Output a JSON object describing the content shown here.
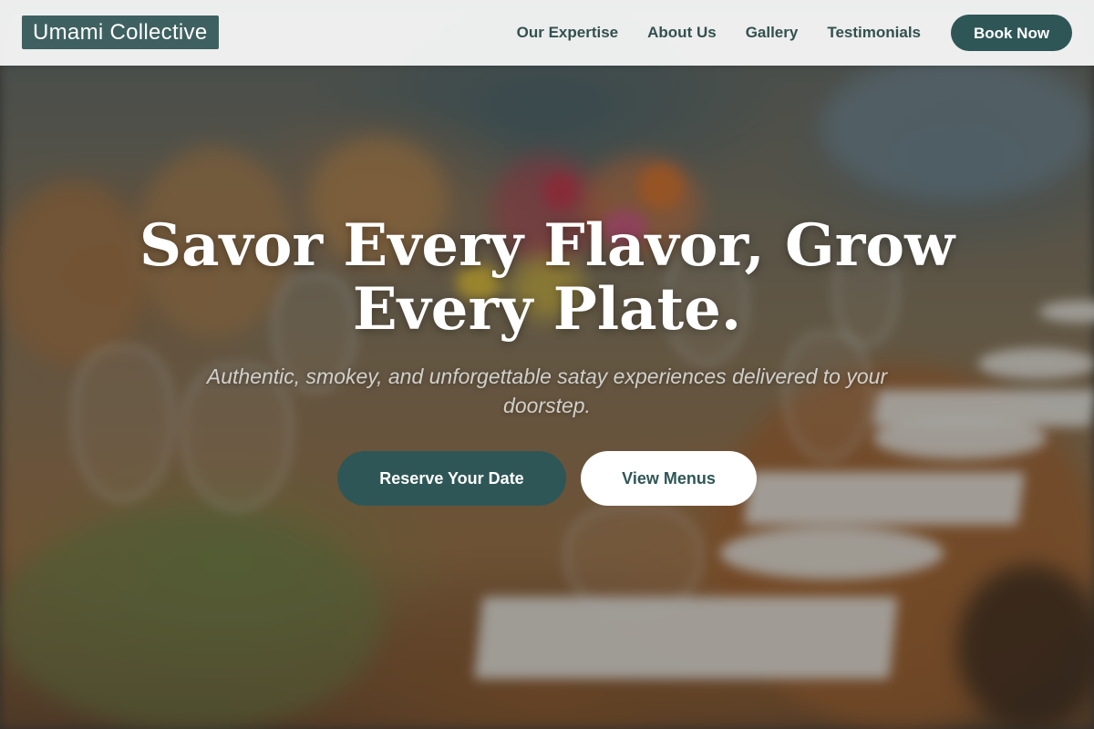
{
  "brand": {
    "name": "Umami Collective"
  },
  "nav": {
    "links": [
      {
        "label": "Our Expertise"
      },
      {
        "label": "About Us"
      },
      {
        "label": "Gallery"
      },
      {
        "label": "Testimonials"
      }
    ],
    "cta_label": "Book Now"
  },
  "hero": {
    "title": "Savor Every Flavor, Grow Every Plate.",
    "subtitle": "Authentic, smokey, and unforgettable satay experiences delivered to your doorstep.",
    "primary_button": "Reserve Your Date",
    "secondary_button": "View Menus",
    "background_image": "blurred-banquet-table-with-glasses-plates-and-flowers"
  },
  "colors": {
    "brand_teal": "#2f5656",
    "brand_badge": "#3f6060",
    "nav_text": "#33504f",
    "nav_background": "#f4f5f4"
  }
}
